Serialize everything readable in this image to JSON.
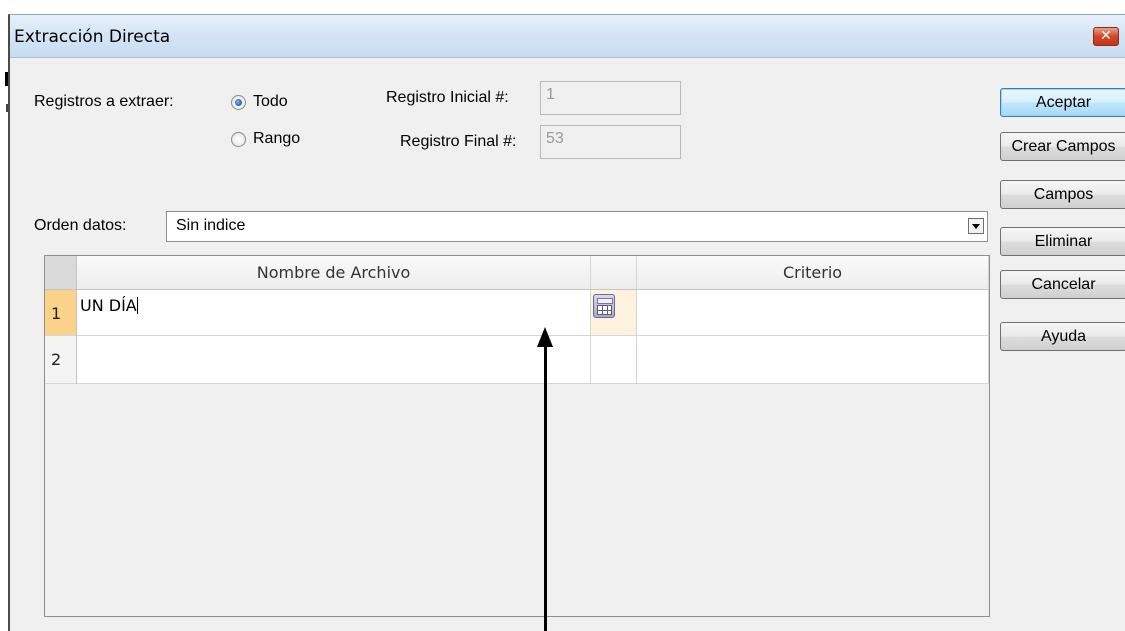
{
  "window": {
    "title": "Extracción Directa",
    "close_glyph": "✕"
  },
  "extract": {
    "label": "Registros a extraer:",
    "option_all": "Todo",
    "option_range": "Rango",
    "selected": "Todo",
    "start_label": "Registro Inicial #:",
    "start_value": "1",
    "end_label": "Registro Final #:",
    "end_value": "53"
  },
  "order": {
    "label": "Orden datos:",
    "value": "Sin indice"
  },
  "grid": {
    "columns": [
      "Nombre de Archivo",
      "",
      "Criterio"
    ],
    "rows": [
      {
        "num": "1",
        "nombre": "UN DÍA",
        "criterio": ""
      },
      {
        "num": "2",
        "nombre": "",
        "criterio": ""
      }
    ]
  },
  "buttons": {
    "accept": "Aceptar",
    "create_fields": "Crear Campos",
    "fields": "Campos",
    "delete": "Eliminar",
    "cancel": "Cancelar",
    "help": "Ayuda"
  },
  "icons": {
    "close": "close-icon",
    "calculator": "calculator-icon",
    "dropdown": "chevron-down-icon"
  },
  "colors": {
    "selected_row": "#fbd28a",
    "title_bar": "#d6e5f6",
    "close_button": "#d2472b"
  }
}
